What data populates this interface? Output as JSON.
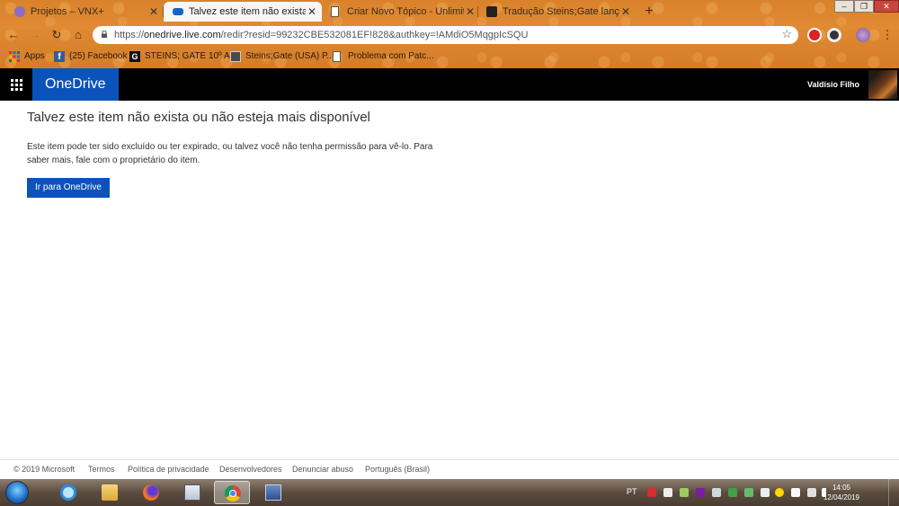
{
  "browser": {
    "tabs": [
      {
        "title": "Projetos – VNX+",
        "close": "✕"
      },
      {
        "title": "Talvez este item não exista ou não",
        "close": "✕"
      },
      {
        "title": "Criar Novo Tópico - Unlimited Vi",
        "close": "✕"
      },
      {
        "title": "Tradução Steins;Gate lançada! –",
        "close": "✕"
      }
    ],
    "new_tab": "+",
    "window_controls": {
      "minimize": "–",
      "restore": "❐",
      "close": "✕"
    },
    "nav": {
      "back": "←",
      "forward": "→",
      "reload": "↻",
      "home": "⌂"
    },
    "url_scheme": "https://",
    "url_host": "onedrive.live.com",
    "url_path": "/redir?resid=99232CBE532081EF!828&authkey=!AMdiO5MqgpIcSQU",
    "star": "☆",
    "bookmarks": [
      {
        "label": "Apps"
      },
      {
        "label": "(25) Facebook"
      },
      {
        "label": "STEINS; GATE 10º A..."
      },
      {
        "label": "Steins;Gate (USA) P..."
      },
      {
        "label": "Problema com Patc..."
      }
    ]
  },
  "header": {
    "brand": "OneDrive",
    "user_name": "Valdisio Filho",
    "brand_color": "#0b53ba"
  },
  "main": {
    "title": "Talvez este item não exista ou não esteja mais disponível",
    "message": "Este item pode ter sido excluído ou ter expirado, ou talvez você não tenha permissão para vê-lo. Para saber mais, fale com o proprietário do item.",
    "cta_label": "Ir para OneDrive"
  },
  "footer": {
    "copyright": "© 2019 Microsoft",
    "links": [
      "Termos",
      "Política de privacidade",
      "Desenvolvedores",
      "Denunciar abuso",
      "Português (Brasil)"
    ]
  },
  "taskbar": {
    "lang": "PT",
    "time": "14:05",
    "date": "12/04/2019"
  }
}
